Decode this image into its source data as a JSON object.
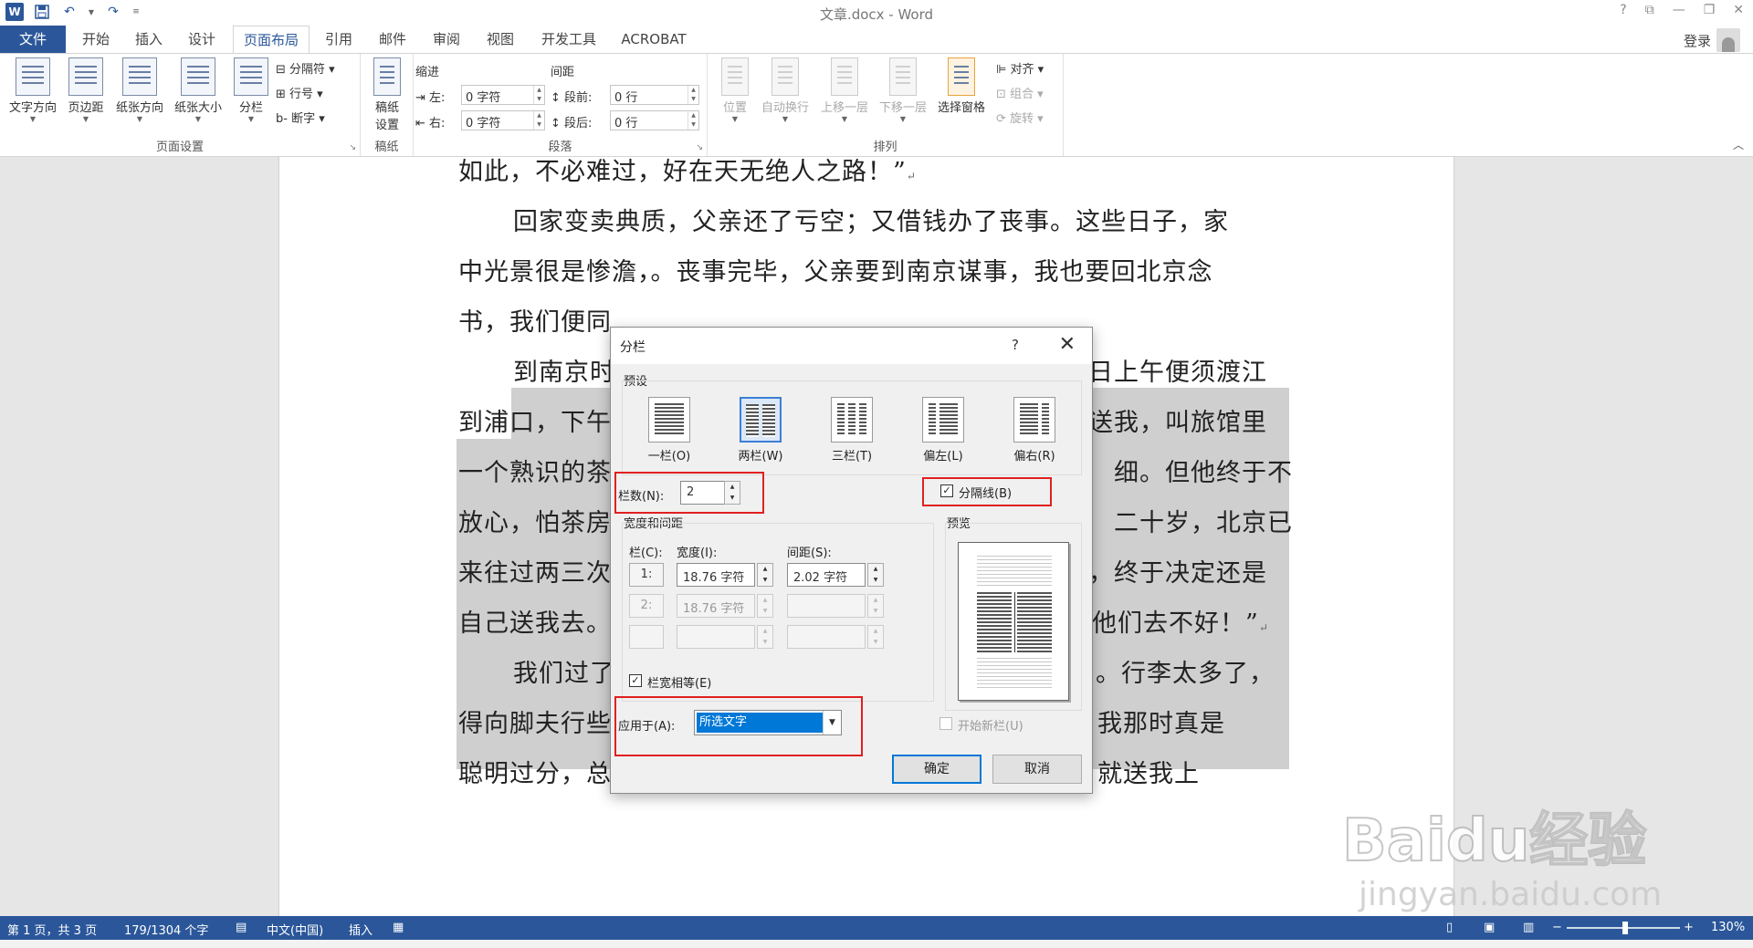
{
  "titlebar": {
    "title": "文章.docx - Word",
    "help": "?",
    "ribbon_display": "⧉",
    "minimize": "—",
    "restore": "❐",
    "close": "✕"
  },
  "tabs": [
    "文件",
    "开始",
    "插入",
    "设计",
    "页面布局",
    "引用",
    "邮件",
    "审阅",
    "视图",
    "开发工具",
    "ACROBAT"
  ],
  "active_tab": "页面布局",
  "account": {
    "login": "登录"
  },
  "ribbon": {
    "page_setup": {
      "label": "页面设置",
      "text_direction": "文字方向",
      "margins": "页边距",
      "orientation": "纸张方向",
      "size": "纸张大小",
      "columns": "分栏",
      "breaks": "分隔符",
      "line_numbers": "行号",
      "hyphenation": "断字"
    },
    "draft_paper": {
      "label": "稿纸",
      "button_line1": "稿纸",
      "button_line2": "设置"
    },
    "paragraph": {
      "label": "段落",
      "indent_header": "缩进",
      "spacing_header": "间距",
      "left_label": "左:",
      "left_value": "0 字符",
      "right_label": "右:",
      "right_value": "0 字符",
      "before_label": "段前:",
      "before_value": "0 行",
      "after_label": "段后:",
      "after_value": "0 行"
    },
    "arrange": {
      "label": "排列",
      "position": "位置",
      "wrap_text": "自动换行",
      "bring_forward": "上移一层",
      "send_backward": "下移一层",
      "selection_pane": "选择窗格",
      "align": "对齐",
      "group": "组合",
      "rotate": "旋转"
    }
  },
  "document": {
    "lines": [
      "如此，不必难过，好在天无绝人之路！”",
      "回家变卖典质，父亲还了亏空；又借钱办了丧事。这些日子，家",
      "中光景很是惨澹，。丧事完毕，父亲要到南京谋事，我也要回北京念",
      "书，我们便同",
      "到南京时",
      "日上午便须渡江",
      "到浦口，下午",
      "送我，叫旅馆里",
      "一个熟识的茶",
      "细。但他终于不",
      "放心，怕茶房",
      "二十岁，北京已",
      "来往过两三次",
      "，终于决定还是",
      "自己送我去。",
      "他们去不好！”",
      "我们过了江，进了车站。我买票，他忙着照看行李。行李太多了，",
      "得向脚夫行些小费才可过去。他便又忙着和他们讲价钱。我那时真是",
      "聪明过分，总觉他说话不大漂亮，非自己插嘴不可。但他终于讲定了价钱；就送我上"
    ],
    "visible": {
      "l16": "我们过了",
      "l16b": "。行李太多了，",
      "l19": "聪明过分，总觉他说话不大漂亮，但他终于讲定了价钱，就送我上"
    }
  },
  "dialog": {
    "title": "分栏",
    "help": "?",
    "close": "✕",
    "presets_label": "预设",
    "presets": [
      "一栏(O)",
      "两栏(W)",
      "三栏(T)",
      "偏左(L)",
      "偏右(R)"
    ],
    "selected_preset": "两栏(W)",
    "num_columns_label": "栏数(N):",
    "num_columns_value": "2",
    "line_between_label": "分隔线(B)",
    "line_between_checked": true,
    "width_spacing_label": "宽度和间距",
    "col_header": "栏(C):",
    "width_header": "宽度(I):",
    "spacing_header": "间距(S):",
    "rows": [
      {
        "col": "1:",
        "width": "18.76 字符",
        "spacing": "2.02 字符",
        "enabled": true
      },
      {
        "col": "2:",
        "width": "18.76 字符",
        "spacing": "",
        "enabled": false
      },
      {
        "col": "",
        "width": "",
        "spacing": "",
        "enabled": false
      }
    ],
    "equal_width_label": "栏宽相等(E)",
    "equal_width_checked": true,
    "preview_label": "预览",
    "apply_to_label": "应用于(A):",
    "apply_to_value": "所选文字",
    "start_new_column_label": "开始新栏(U)",
    "ok": "确定",
    "cancel": "取消"
  },
  "statusbar": {
    "page": "第 1 页，共 3 页",
    "words": "179/1304 个字",
    "language": "中文(中国)",
    "mode": "插入",
    "zoom": "130%",
    "zoom_fraction": 0.52
  },
  "watermark": {
    "brand": "Baidu经验",
    "url": "jingyan.baidu.com"
  },
  "colors": {
    "accent": "#2b579a",
    "selection": "#cfcfcf",
    "highlight_box": "#e02020",
    "combo_selected": "#0078d7"
  }
}
